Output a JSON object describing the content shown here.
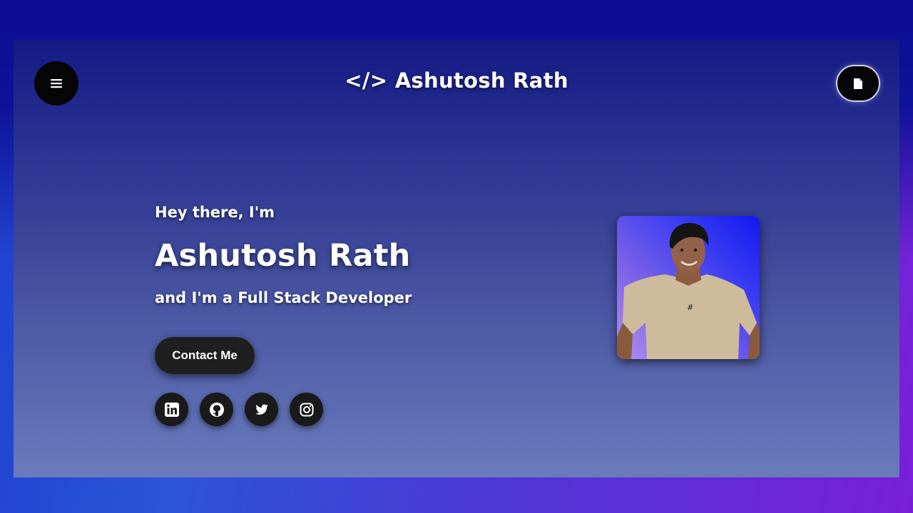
{
  "header": {
    "brand": "</> Ashutosh Rath",
    "menu_icon": "hamburger-menu-icon",
    "resume_icon": "document-icon"
  },
  "hero": {
    "greeting": "Hey there, I'm",
    "name": "Ashutosh Rath",
    "role": "and I'm a Full Stack Developer",
    "cta_label": "Contact Me"
  },
  "socials": [
    {
      "icon": "linkedin-icon"
    },
    {
      "icon": "github-icon"
    },
    {
      "icon": "twitter-icon"
    },
    {
      "icon": "instagram-icon"
    }
  ],
  "colors": {
    "frame_top": "#131a86",
    "frame_bottom": "#6a7bbc",
    "button_bg": "#1f1f1f",
    "text": "#ffffff"
  }
}
